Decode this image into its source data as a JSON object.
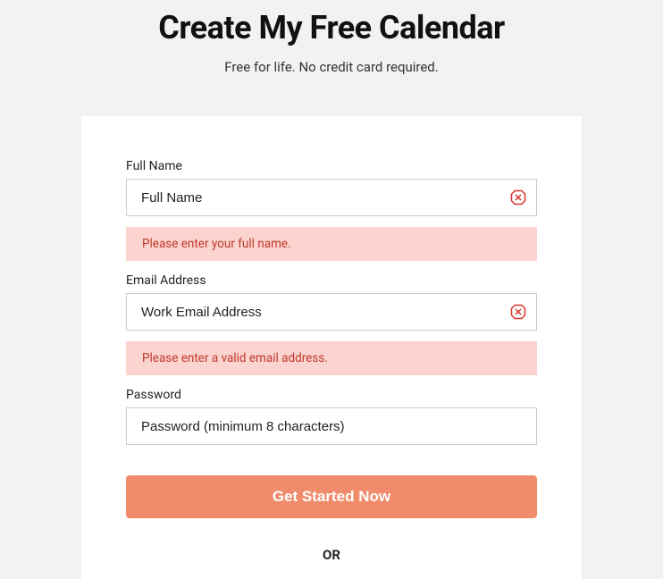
{
  "header": {
    "title": "Create My Free Calendar",
    "subtitle": "Free for life. No credit card required."
  },
  "form": {
    "full_name": {
      "label": "Full Name",
      "placeholder": "Full Name",
      "error": "Please enter your full name."
    },
    "email": {
      "label": "Email Address",
      "placeholder": "Work Email Address",
      "error": "Please enter a valid email address."
    },
    "password": {
      "label": "Password",
      "placeholder": "Password (minimum 8 characters)"
    },
    "submit_label": "Get Started Now",
    "or_label": "OR"
  },
  "colors": {
    "accent": "#f08b6b",
    "error_bg": "#fbd3cf",
    "error_text": "#c0392b"
  }
}
